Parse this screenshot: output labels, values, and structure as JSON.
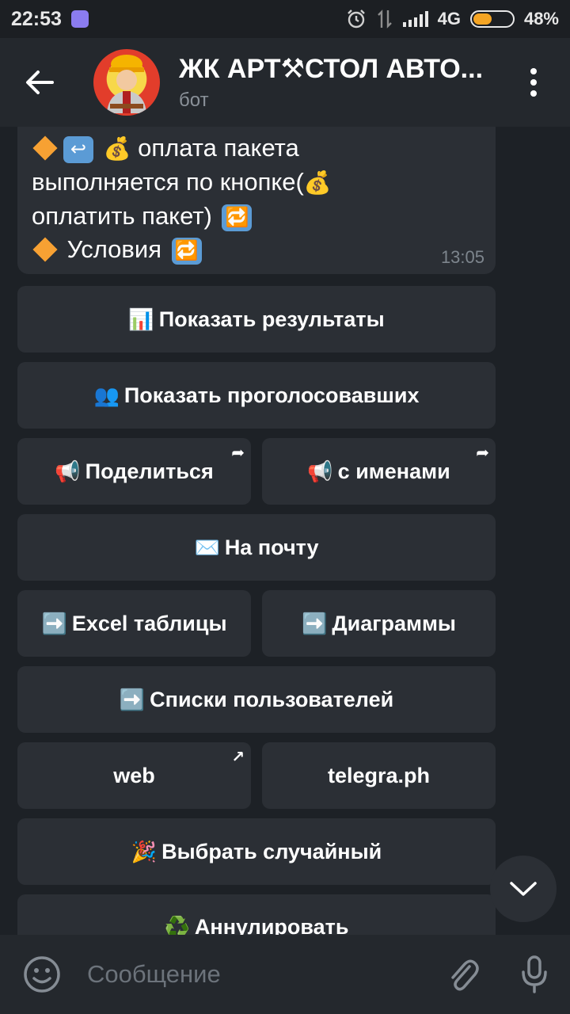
{
  "status_bar": {
    "time": "22:53",
    "network": "4G",
    "battery_percent_label": "48%",
    "battery_level": 0.48
  },
  "header": {
    "title": "ЖК АРТ⚒СТОЛ АВТО...",
    "subtitle": "бот"
  },
  "message": {
    "line1": "оплата пакета",
    "line2": "выполняется по кнопке(",
    "line3": "оплатить пакет)",
    "line4": "Условия",
    "time": "13:05"
  },
  "keyboard": {
    "show_results": "Показать результаты",
    "show_voters": "Показать проголосовавших",
    "share": "Поделиться",
    "with_names": "с именами",
    "to_mail": "На почту",
    "excel": "Excel таблицы",
    "charts": "Диаграммы",
    "user_lists": "Списки пользователей",
    "web": "web",
    "telegraph": "telegra.ph",
    "random": "Выбрать случайный",
    "cancel": "Аннулировать"
  },
  "input": {
    "placeholder": "Сообщение"
  },
  "colors": {
    "background": "#1d2126",
    "bubble": "#2b2f35",
    "header": "#24282d",
    "accent_orange": "#f7a133"
  }
}
